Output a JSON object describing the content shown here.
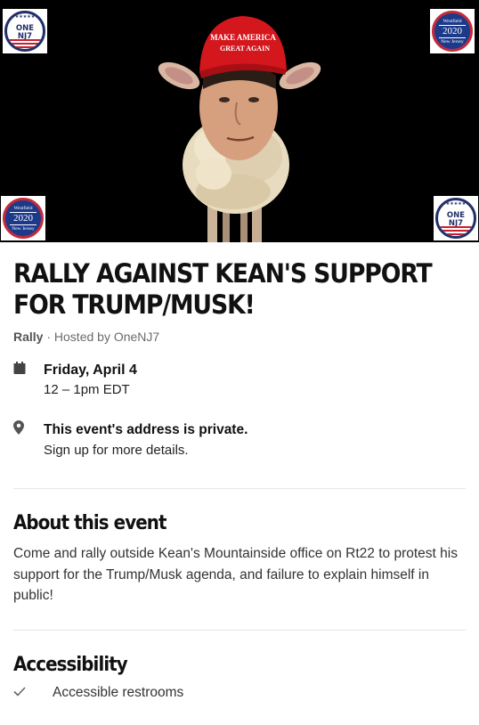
{
  "hero": {
    "cap_text_line1": "MAKE AMERICA",
    "cap_text_line2": "GREAT AGAIN",
    "badge_one": {
      "line1": "ONE",
      "line2": "NJ7"
    },
    "badge_westfield": {
      "line1": "Westfield",
      "year": "2020",
      "line3": "New Jersey"
    }
  },
  "event": {
    "title": "RALLY AGAINST KEAN'S SUPPORT FOR TRUMP/MUSK!",
    "type": "Rally",
    "hosted_by": " · Hosted by OneNJ7",
    "date": "Friday, April 4",
    "time": "12 – 1pm EDT",
    "address_title": "This event's address is private.",
    "address_sub": "Sign up for more details."
  },
  "about": {
    "heading": "About this event",
    "body": "Come and rally outside Kean's Mountainside office on Rt22 to protest his support for the Trump/Musk agenda, and failure to explain himself in public!"
  },
  "accessibility": {
    "heading": "Accessibility",
    "items": [
      "Accessible restrooms"
    ]
  },
  "icons": {
    "date": "calendar-icon",
    "location": "map-pin-icon",
    "check": "check-icon"
  },
  "colors": {
    "hat_red": "#d4161d",
    "badge_navy": "#22306a",
    "badge_red": "#c8202f"
  }
}
